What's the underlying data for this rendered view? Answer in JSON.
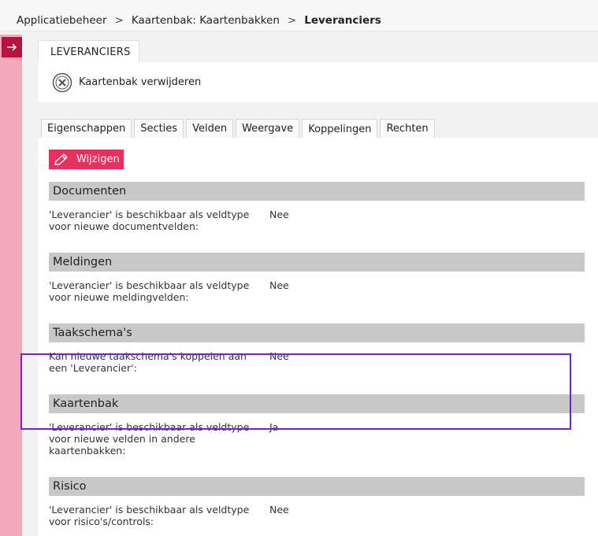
{
  "breadcrumb": {
    "items": [
      "Applicatiebeheer",
      "Kaartenbak: Kaartenbakken",
      "Leveranciers"
    ],
    "separator": ">"
  },
  "header": {
    "tab_label": "LEVERANCIERS",
    "delete_action": "Kaartenbak verwijderen"
  },
  "tabs": [
    "Eigenschappen",
    "Secties",
    "Velden",
    "Weergave",
    "Koppelingen",
    "Rechten"
  ],
  "active_tab": "Koppelingen",
  "edit_button": "Wijzigen",
  "sections": [
    {
      "title": "Documenten",
      "question": "'Leverancier' is beschikbaar als veldtype voor nieuwe documentvelden:",
      "answer": "Nee"
    },
    {
      "title": "Meldingen",
      "question": "'Leverancier' is beschikbaar als veldtype voor nieuwe meldingvelden:",
      "answer": "Nee"
    },
    {
      "title": "Taakschema's",
      "question": "Kan nieuwe taakschema's koppelen aan een 'Leverancier':",
      "answer": "Nee"
    },
    {
      "title": "Kaartenbak",
      "question": "'Leverancier' is beschikbaar als veldtype voor nieuwe velden in andere kaartenbakken:",
      "answer": "Ja"
    },
    {
      "title": "Risico",
      "question": "'Leverancier' is beschikbaar als veldtype voor risico's/controls:",
      "answer": "Nee"
    }
  ],
  "colors": {
    "accent": "#e8305e",
    "sidebar": "#f4a9bb",
    "sidebar_button": "#b8133f",
    "highlight": "#7a1fd1",
    "section_header": "#c8c8c8"
  }
}
